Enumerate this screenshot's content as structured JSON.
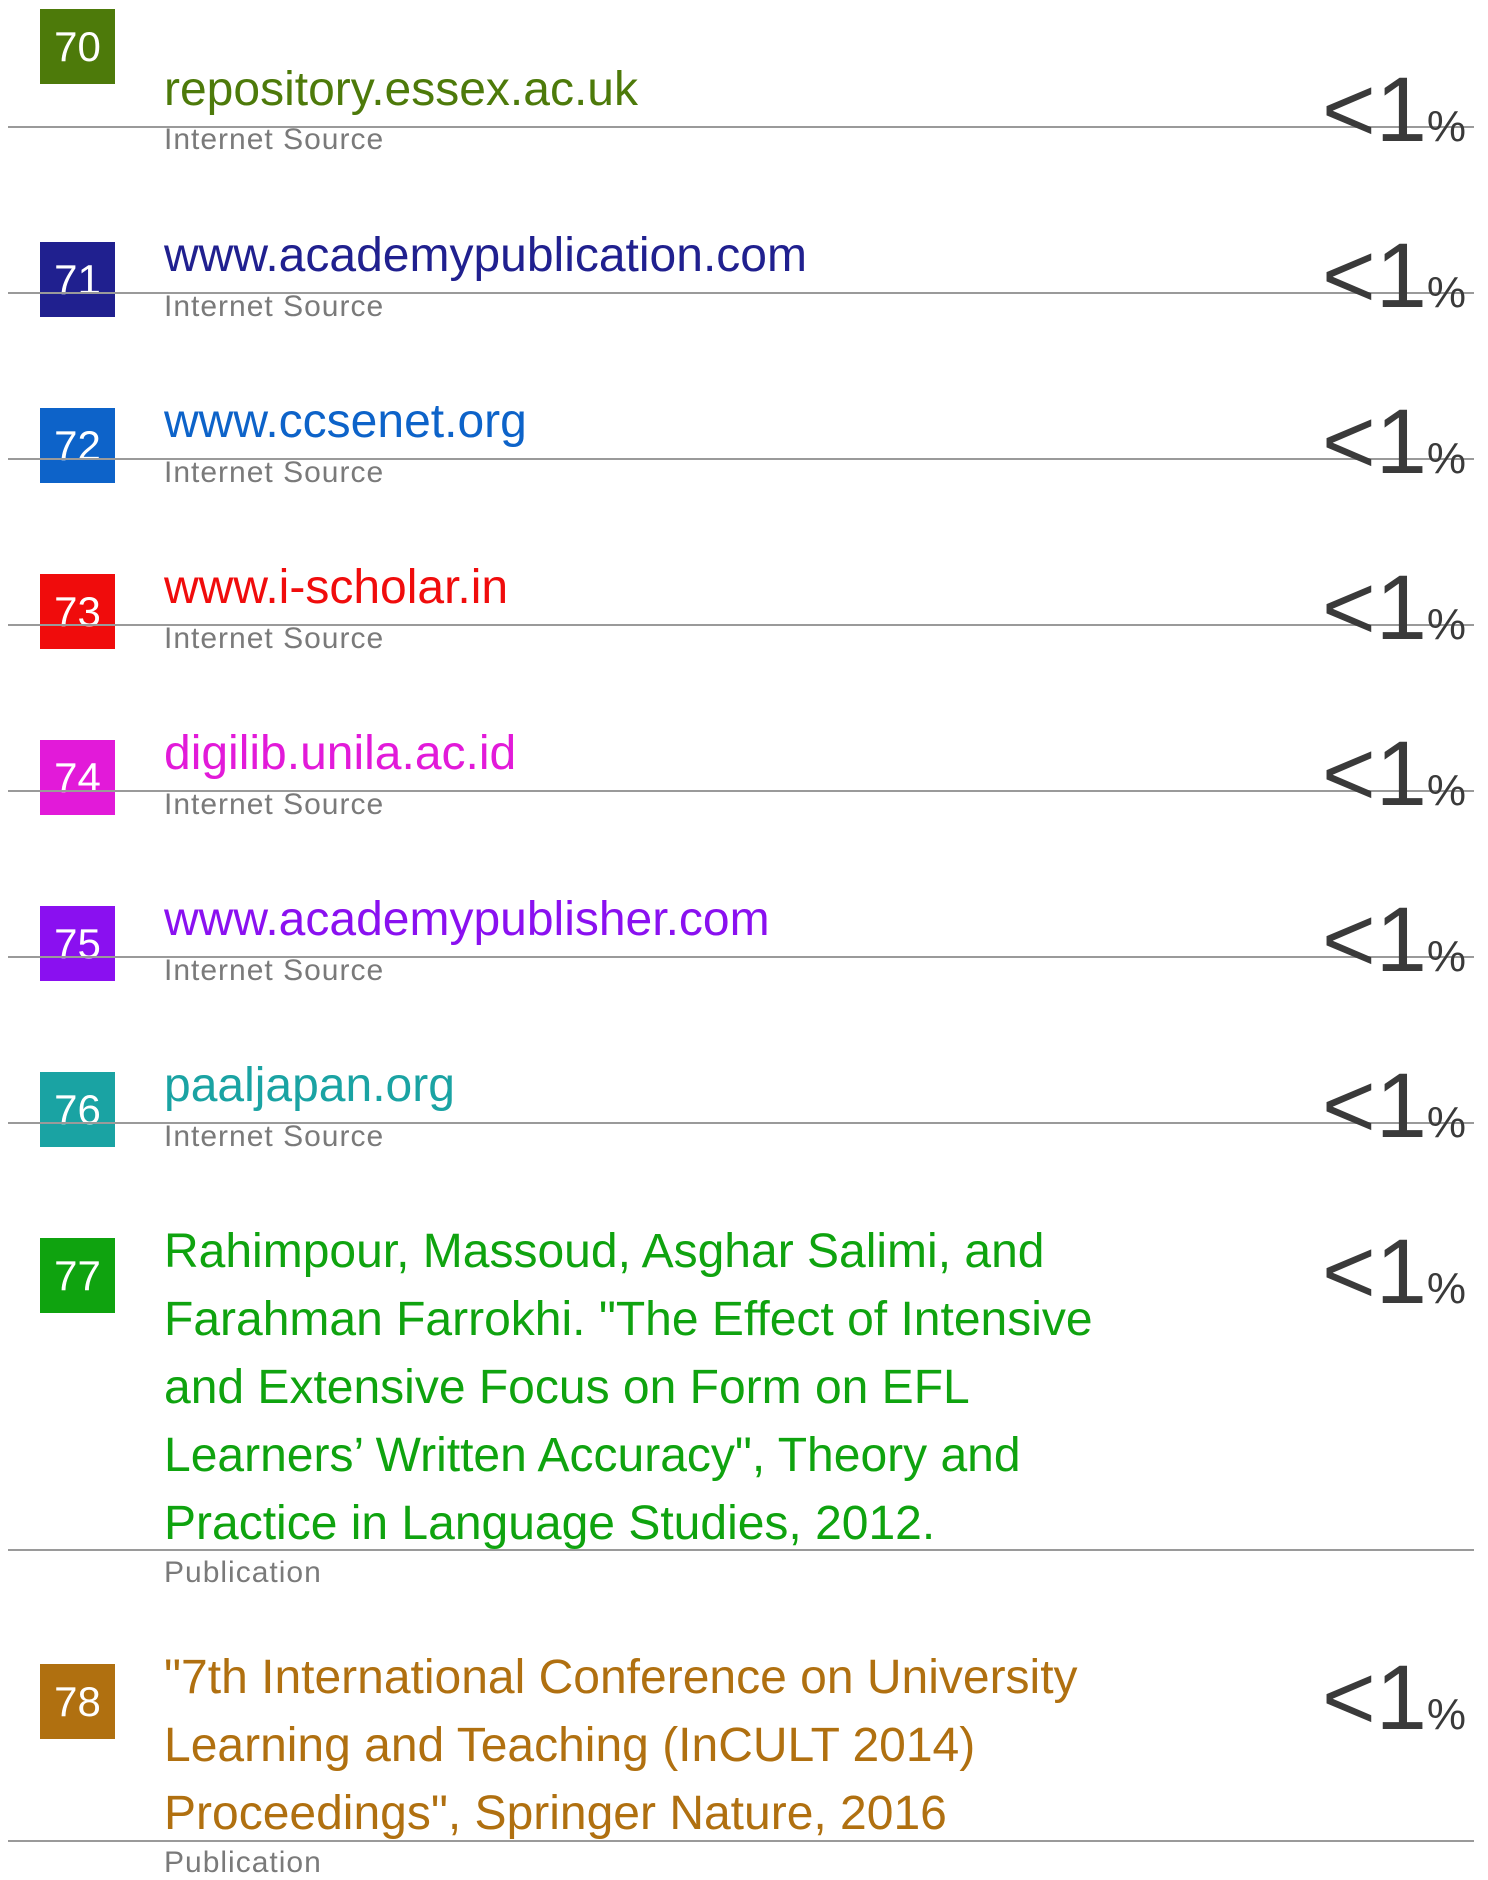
{
  "entries": [
    {
      "number": "70",
      "title_lines": [
        "repository.essex.ac.uk"
      ],
      "source_type": "Internet Source",
      "percent": "<1",
      "percent_symbol": "%",
      "color": "#4d7a0a"
    },
    {
      "number": "71",
      "title_lines": [
        "www.academypublication.com"
      ],
      "source_type": "Internet Source",
      "percent": "<1",
      "percent_symbol": "%",
      "color": "#20208f"
    },
    {
      "number": "72",
      "title_lines": [
        "www.ccsenet.org"
      ],
      "source_type": "Internet Source",
      "percent": "<1",
      "percent_symbol": "%",
      "color": "#0d63c9"
    },
    {
      "number": "73",
      "title_lines": [
        "www.i-scholar.in"
      ],
      "source_type": "Internet Source",
      "percent": "<1",
      "percent_symbol": "%",
      "color": "#f00c0c"
    },
    {
      "number": "74",
      "title_lines": [
        "digilib.unila.ac.id"
      ],
      "source_type": "Internet Source",
      "percent": "<1",
      "percent_symbol": "%",
      "color": "#e21ad9"
    },
    {
      "number": "75",
      "title_lines": [
        "www.academypublisher.com"
      ],
      "source_type": "Internet Source",
      "percent": "<1",
      "percent_symbol": "%",
      "color": "#8a10f0"
    },
    {
      "number": "76",
      "title_lines": [
        "paaljapan.org"
      ],
      "source_type": "Internet Source",
      "percent": "<1",
      "percent_symbol": "%",
      "color": "#1aa3a3"
    },
    {
      "number": "77",
      "title_lines": [
        "Rahimpour, Massoud, Asghar Salimi, and",
        "Farahman Farrokhi. \"The Effect of Intensive",
        "and Extensive Focus on Form on EFL",
        "Learners’ Written Accuracy\", Theory and",
        "Practice in Language Studies, 2012."
      ],
      "source_type": "Publication",
      "percent": "<1",
      "percent_symbol": "%",
      "color": "#0fa30f"
    },
    {
      "number": "78",
      "title_lines": [
        "\"7th International Conference on University",
        "Learning and Teaching (InCULT 2014)",
        "Proceedings\", Springer Nature, 2016"
      ],
      "source_type": "Publication",
      "percent": "<1",
      "percent_symbol": "%",
      "color": "#b07010"
    }
  ]
}
